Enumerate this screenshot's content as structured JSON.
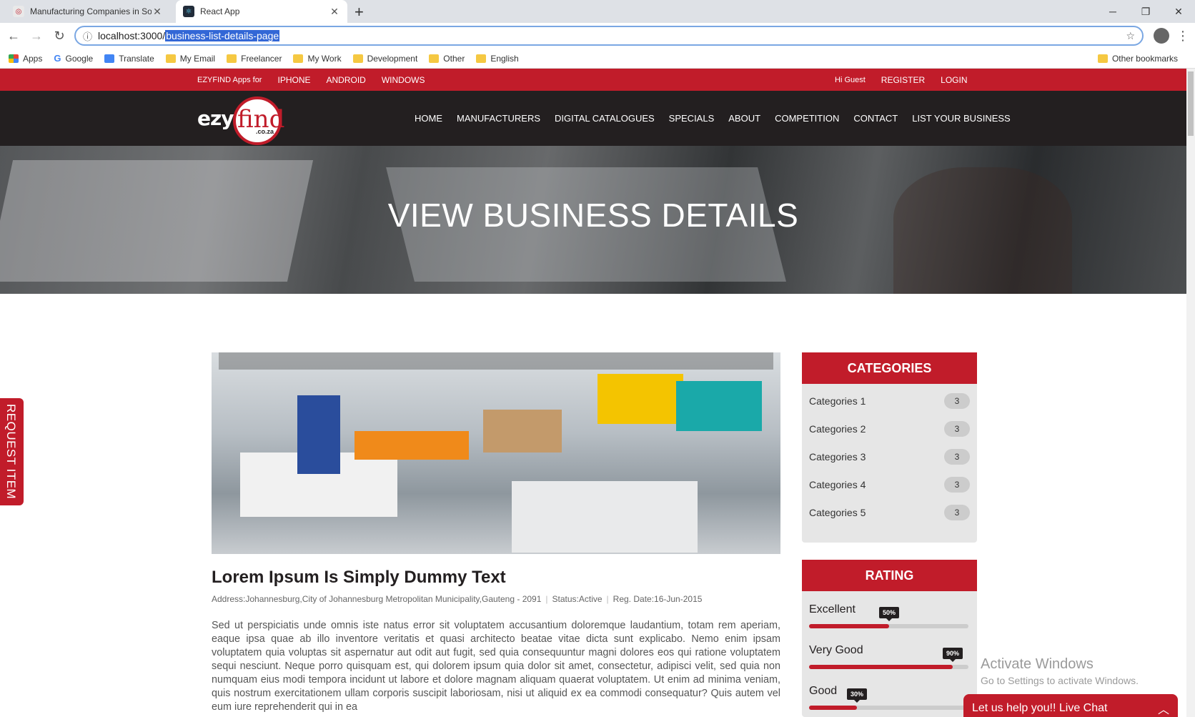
{
  "browser": {
    "tabs": [
      {
        "title": "Manufacturing Companies in Sou",
        "favicon": "ezyfind-favicon"
      },
      {
        "title": "React App",
        "favicon": "react-favicon"
      }
    ],
    "url_host": "localhost:3000/",
    "url_path": "business-list-details-page",
    "bookmarks": [
      {
        "label": "Apps",
        "icon": "apps-grid-icon"
      },
      {
        "label": "Google",
        "icon": "google-icon"
      },
      {
        "label": "Translate",
        "icon": "translate-icon"
      },
      {
        "label": "My Email",
        "icon": "folder-icon"
      },
      {
        "label": "Freelancer",
        "icon": "folder-icon"
      },
      {
        "label": "My Work",
        "icon": "folder-icon"
      },
      {
        "label": "Development",
        "icon": "folder-icon"
      },
      {
        "label": "Other",
        "icon": "folder-icon"
      },
      {
        "label": "English",
        "icon": "folder-icon"
      }
    ],
    "other_bookmarks": "Other bookmarks"
  },
  "topbar": {
    "apps_label": "EZYFIND Apps for",
    "apps": [
      "IPHONE",
      "ANDROID",
      "WINDOWS"
    ],
    "greeting": "Hi Guest",
    "register": "REGISTER",
    "login": "LOGIN"
  },
  "logo": {
    "ezy": "ezy",
    "find": "find",
    "domain": ".co.za"
  },
  "nav": [
    "HOME",
    "MANUFACTURERS",
    "DIGITAL CATALOGUES",
    "SPECIALS",
    "ABOUT",
    "COMPETITION",
    "CONTACT",
    "LIST YOUR BUSINESS"
  ],
  "hero": {
    "title": "VIEW BUSINESS DETAILS"
  },
  "request_tab": "REQUEST ITEM",
  "business": {
    "title": "Lorem Ipsum Is Simply Dummy Text",
    "address": "Address:Johannesburg,City of Johannesburg Metropolitan Municipality,Gauteng - 2091",
    "status": "Status:Active",
    "reg_date": "Reg. Date:16-Jun-2015",
    "description": "Sed ut perspiciatis unde omnis iste natus error sit voluptatem accusantium doloremque laudantium, totam rem aperiam, eaque ipsa quae ab illo inventore veritatis et quasi architecto beatae vitae dicta sunt explicabo. Nemo enim ipsam voluptatem quia voluptas sit aspernatur aut odit aut fugit, sed quia consequuntur magni dolores eos qui ratione voluptatem sequi nesciunt. Neque porro quisquam est, qui dolorem ipsum quia dolor sit amet, consectetur, adipisci velit, sed quia non numquam eius modi tempora incidunt ut labore et dolore magnam aliquam quaerat voluptatem. Ut enim ad minima veniam, quis nostrum exercitationem ullam corporis suscipit laboriosam, nisi ut aliquid ex ea commodi consequatur? Quis autem vel eum iure reprehenderit qui in ea"
  },
  "categories": {
    "title": "CATEGORIES",
    "items": [
      {
        "label": "Categories 1",
        "count": "3"
      },
      {
        "label": "Categories 2",
        "count": "3"
      },
      {
        "label": "Categories 3",
        "count": "3"
      },
      {
        "label": "Categories 4",
        "count": "3"
      },
      {
        "label": "Categories 5",
        "count": "3"
      }
    ]
  },
  "rating": {
    "title": "RATING",
    "items": [
      {
        "label": "Excellent",
        "percent_label": "50%",
        "percent": 50
      },
      {
        "label": "Very Good",
        "percent_label": "90%",
        "percent": 90
      },
      {
        "label": "Good",
        "percent_label": "30%",
        "percent": 30
      }
    ]
  },
  "watermark": {
    "line1": "Activate Windows",
    "line2": "Go to Settings to activate Windows."
  },
  "livechat": {
    "label": "Let us help you!! Live Chat"
  },
  "colors": {
    "brand_red": "#c11c2a",
    "nav_dark": "#231f20",
    "sidebar_bg": "#e6e6e6"
  }
}
